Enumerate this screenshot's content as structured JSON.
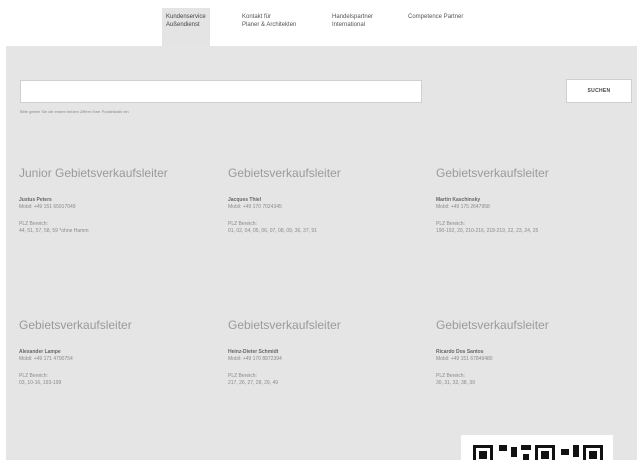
{
  "nav": {
    "tabs": [
      {
        "line1": "Kundenservice",
        "line2": "Außendienst",
        "active": true
      },
      {
        "line1": "Kontakt für",
        "line2": "Planer & Architekten",
        "active": false
      },
      {
        "line1": "Handelspartner",
        "line2": "International",
        "active": false
      },
      {
        "line1": "Competence Partner",
        "line2": "",
        "active": false
      }
    ]
  },
  "search": {
    "value": "",
    "hint": "Bitte geben Sie die ersten beiden Ziffern Ihrer Postleitzahl ein",
    "button_label": "SUCHEN"
  },
  "reps": [
    {
      "title": "Junior Gebietsverkaufsleiter",
      "name": "Justus Peters",
      "mobile": "Mobil: +49 151 65917049",
      "plz_label": "PLZ Bereich:",
      "plz": "44, 51, 57, 58, 59 *ohne Hamm"
    },
    {
      "title": "Gebietsverkaufsleiter",
      "name": "Jacques Thiel",
      "mobile": "Mobil: +49 170 7024345",
      "plz_label": "PLZ Bereich:",
      "plz": "01, 02, 04, 05, 06, 07, 08, 09, 36, 37, 91"
    },
    {
      "title": "Gebietsverkaufsleiter",
      "name": "Martin Kaschinsky",
      "mobile": "Mobil: +49 175 2647958",
      "plz_label": "PLZ Bereich:",
      "plz": "190-192, 20, 210-216, 218-219, 22, 23, 24, 25"
    },
    {
      "title": "Gebietsverkaufsleiter",
      "name": "Alexander Lampe",
      "mobile": "Mobil: +49 171 4790754",
      "plz_label": "PLZ Bereich:",
      "plz": "03, 10-16, 193-199"
    },
    {
      "title": "Gebietsverkaufsleiter",
      "name": "Heinz-Dieter Schmidt",
      "mobile": "Mobil: +49 170 8872394",
      "plz_label": "PLZ Bereich:",
      "plz": "217, 26, 27, 28, 29, 49"
    },
    {
      "title": "Gebietsverkaufsleiter",
      "name": "Ricardo Dos Santos",
      "mobile": "Mobil: +49 151 67849480",
      "plz_label": "PLZ Bereich:",
      "plz": "30, 31, 32, 38, 39"
    }
  ]
}
